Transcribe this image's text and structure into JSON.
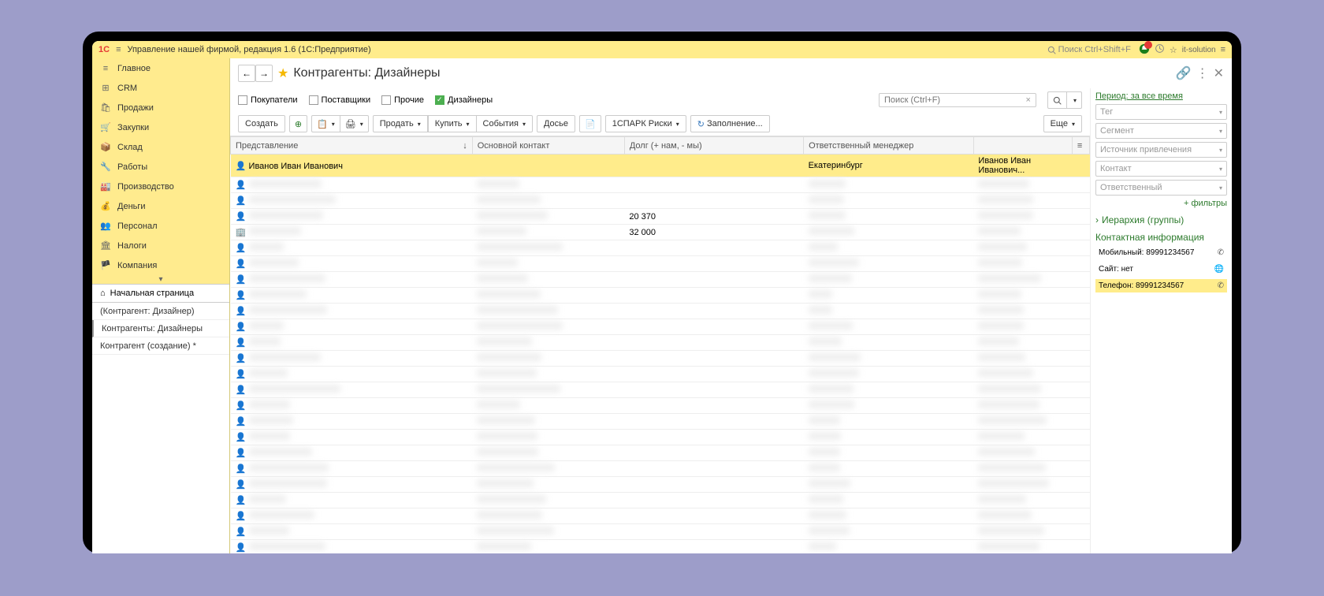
{
  "title_bar": {
    "app_title": "Управление нашей фирмой, редакция 1.6  (1С:Предприятие)",
    "search_placeholder": "Поиск Ctrl+Shift+F",
    "user_name": "it-solution"
  },
  "sidebar": {
    "items": [
      {
        "icon": "≡",
        "label": "Главное"
      },
      {
        "icon": "⊞",
        "label": "CRM"
      },
      {
        "icon": "🛍",
        "label": "Продажи"
      },
      {
        "icon": "🛒",
        "label": "Закупки"
      },
      {
        "icon": "📦",
        "label": "Склад"
      },
      {
        "icon": "🔧",
        "label": "Работы"
      },
      {
        "icon": "🏭",
        "label": "Производство"
      },
      {
        "icon": "💰",
        "label": "Деньги"
      },
      {
        "icon": "👥",
        "label": "Персонал"
      },
      {
        "icon": "🏛",
        "label": "Налоги"
      },
      {
        "icon": "🏴",
        "label": "Компания"
      }
    ],
    "home_label": "Начальная страница",
    "pages": [
      {
        "label": "(Контрагент: Дизайнер)"
      },
      {
        "label": "Контрагенты: Дизайнеры",
        "active": true
      },
      {
        "label": "Контрагент (создание) *"
      }
    ]
  },
  "header": {
    "title": "Контрагенты: Дизайнеры"
  },
  "filters": {
    "buyers": "Покупатели",
    "suppliers": "Поставщики",
    "other": "Прочие",
    "designers": "Дизайнеры",
    "search_placeholder": "Поиск (Ctrl+F)",
    "period": "Период: за все время"
  },
  "toolbar": {
    "create": "Создать",
    "sell": "Продать",
    "buy": "Купить",
    "events": "События",
    "dossier": "Досье",
    "spark": "1СПАРК Риски",
    "fill": "Заполнение...",
    "more": "Еще"
  },
  "table": {
    "columns": {
      "name": "Представление",
      "contact": "Основной контакт",
      "debt": "Долг (+ нам, - мы)",
      "manager": "Ответственный менеджер"
    },
    "rows": [
      {
        "name": "Иванов Иван Иванович",
        "contact": "",
        "debt": "",
        "city": "Екатеринбург",
        "manager": "Иванов Иван Иванович...",
        "selected": true
      },
      {
        "blur": true
      },
      {
        "blur": true
      },
      {
        "blur": true,
        "debt": "20 370"
      },
      {
        "blur": true,
        "debt": "32 000",
        "org": true
      },
      {
        "blur": true
      },
      {
        "blur": true
      },
      {
        "blur": true
      },
      {
        "blur": true
      },
      {
        "blur": true
      },
      {
        "blur": true
      },
      {
        "blur": true
      },
      {
        "blur": true
      },
      {
        "blur": true
      },
      {
        "blur": true
      },
      {
        "blur": true
      },
      {
        "blur": true
      },
      {
        "blur": true
      },
      {
        "blur": true
      },
      {
        "blur": true
      },
      {
        "blur": true
      },
      {
        "blur": true
      },
      {
        "blur": true
      },
      {
        "blur": true
      },
      {
        "blur": true
      }
    ]
  },
  "right_panel": {
    "filters": {
      "tag": "Тег",
      "segment": "Сегмент",
      "source": "Источник привлечения",
      "contact": "Контакт",
      "responsible": "Ответственный",
      "more_filters": "+ фильтры"
    },
    "hierarchy": "Иерархия (группы)",
    "contact_info": "Контактная информация",
    "mobile_label": "Мобильный:",
    "mobile_value": "89991234567",
    "site_label": "Сайт:",
    "site_value": "нет",
    "phone_label": "Телефон:",
    "phone_value": "89991234567"
  }
}
